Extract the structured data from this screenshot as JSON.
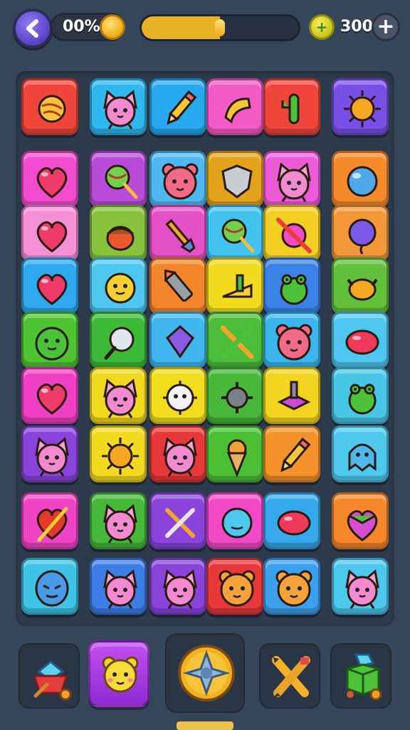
{
  "hud": {
    "progress_percent_label": "00%",
    "coin_count": "300",
    "back_icon": "back-arrow-icon",
    "add_icon": "plus-icon",
    "currency_icon": "coin-icon",
    "level_progress": 0.5
  },
  "board": {
    "rows": [
      [
        {
          "icon": "tangled-yarn-icon",
          "color": "#f0453a"
        },
        {
          "icon": "cat-face-icon",
          "color": "#2fb8f0"
        },
        {
          "icon": "pencil-icon",
          "color": "#27a9f0"
        },
        {
          "icon": "horn-icon",
          "color": "#f25ac6"
        },
        {
          "icon": "cactus-icon",
          "color": "#f0453a"
        },
        {
          "icon": "sun-icon",
          "color": "#7a4fe6"
        }
      ],
      [
        {
          "icon": "heart-icon",
          "color": "#f24bcf"
        },
        {
          "icon": "lollipop-icon",
          "color": "#b84bd8"
        },
        {
          "icon": "pig-face-icon",
          "color": "#4fb8f0"
        },
        {
          "icon": "shield-icon",
          "color": "#e3a21c"
        },
        {
          "icon": "cat-face-icon",
          "color": "#ec5ad8"
        },
        {
          "icon": "bubble-icon",
          "color": "#f6892a"
        }
      ],
      [
        {
          "icon": "heart-icon",
          "color": "#f58fd6"
        },
        {
          "icon": "acorn-icon",
          "color": "#86c23c"
        },
        {
          "icon": "paintbrush-icon",
          "color": "#e450c6"
        },
        {
          "icon": "lollipop-icon",
          "color": "#42c2ef"
        },
        {
          "icon": "crossed-candy-icon",
          "color": "#f2cf22"
        },
        {
          "icon": "balloon-icon",
          "color": "#f3983a"
        }
      ],
      [
        {
          "icon": "heart-icon",
          "color": "#2fa8ee"
        },
        {
          "icon": "smiley-icon",
          "color": "#4fc6f0"
        },
        {
          "icon": "crayon-icon",
          "color": "#f3862a"
        },
        {
          "icon": "cheese-icon",
          "color": "#f2db1e"
        },
        {
          "icon": "frog-icon",
          "color": "#3c82e6"
        },
        {
          "icon": "crab-icon",
          "color": "#62c03a"
        }
      ],
      [
        {
          "icon": "slime-icon",
          "color": "#4ec432"
        },
        {
          "icon": "mirror-icon",
          "color": "#3dba38"
        },
        {
          "icon": "kite-icon",
          "color": "#3fb6ee"
        },
        {
          "icon": "crossed-tools-icon",
          "color": "#4bbd3a"
        },
        {
          "icon": "pig-face-icon",
          "color": "#3ab6ec"
        },
        {
          "icon": "blob-icon",
          "color": "#4fc6f0"
        }
      ],
      [
        {
          "icon": "heart-icon",
          "color": "#ef3fc4"
        },
        {
          "icon": "cat-face-icon",
          "color": "#f2d81e"
        },
        {
          "icon": "puffer-icon",
          "color": "#f2dc1e"
        },
        {
          "icon": "spike-ball-icon",
          "color": "#47b83a"
        },
        {
          "icon": "top-hat-icon",
          "color": "#f2d41e"
        },
        {
          "icon": "frog-icon",
          "color": "#47c6e6"
        }
      ],
      [
        {
          "icon": "cat-face-icon",
          "color": "#8a44dc"
        },
        {
          "icon": "sun-icon",
          "color": "#f2da1e"
        },
        {
          "icon": "cat-face-icon",
          "color": "#e8383a"
        },
        {
          "icon": "ice-cream-icon",
          "color": "#4cbf34"
        },
        {
          "icon": "pencil-icon",
          "color": "#f5922a"
        },
        {
          "icon": "ghost-icon",
          "color": "#4fc8ee"
        }
      ],
      [
        {
          "icon": "feather-heart-icon",
          "color": "#ef44c6"
        },
        {
          "icon": "cat-face-icon",
          "color": "#45b83a"
        },
        {
          "icon": "crossed-brush-icon",
          "color": "#8a44dc"
        },
        {
          "icon": "jelly-icon",
          "color": "#f24ac6"
        },
        {
          "icon": "blob-icon",
          "color": "#36a8ec"
        },
        {
          "icon": "gem-heart-icon",
          "color": "#f5862a"
        }
      ],
      [
        {
          "icon": "alien-face-icon",
          "color": "#3ec2e6"
        },
        {
          "icon": "cat-face-icon",
          "color": "#3c7ee6"
        },
        {
          "icon": "cat-face-icon",
          "color": "#8a44dc"
        },
        {
          "icon": "bear-face-icon",
          "color": "#e8383a"
        },
        {
          "icon": "bear-face-icon",
          "color": "#3ca0ec"
        },
        {
          "icon": "cat-face-icon",
          "color": "#4cc8ec"
        }
      ]
    ]
  },
  "tray": [
    {
      "icon": "gem-cart-icon"
    },
    {
      "icon": "bear-face-icon"
    },
    {
      "icon": "compass-orb-icon"
    },
    {
      "icon": "crossed-pencils-icon"
    },
    {
      "icon": "green-cube-icon"
    }
  ]
}
